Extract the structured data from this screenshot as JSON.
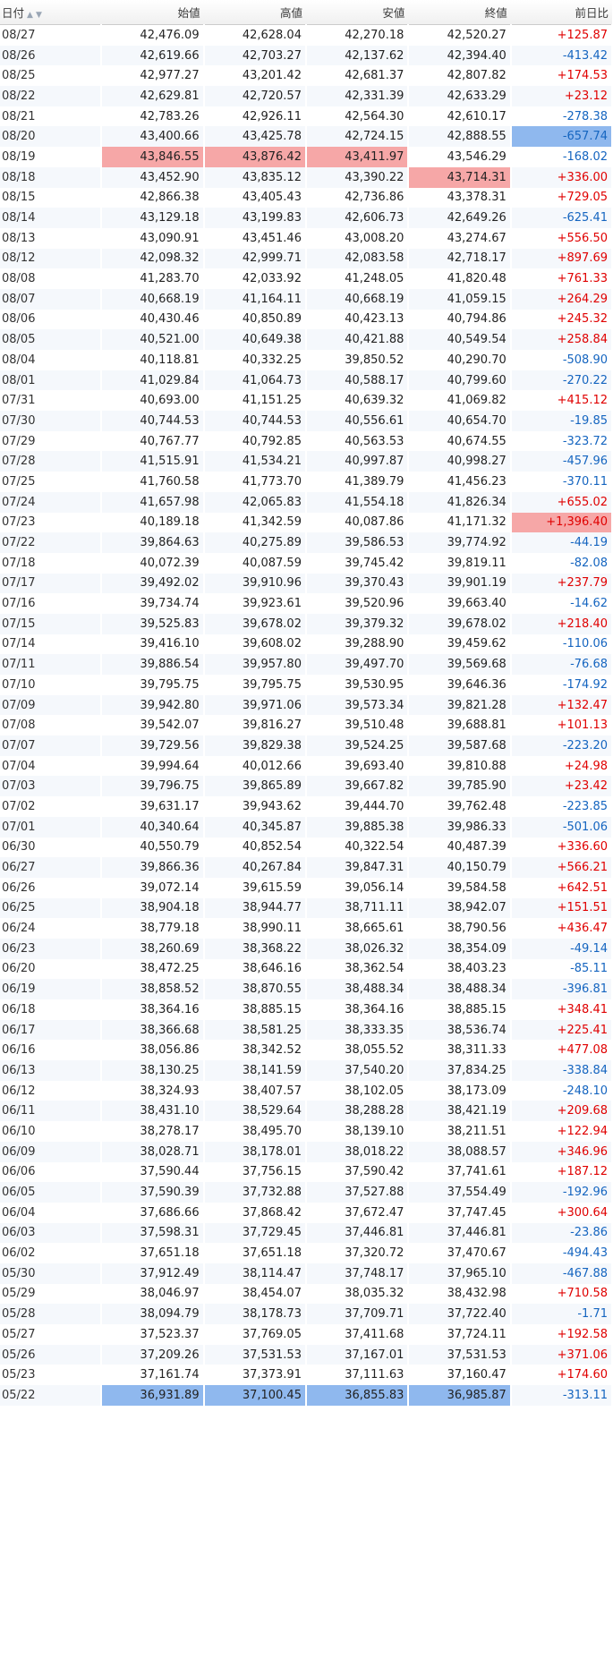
{
  "table": {
    "headers": {
      "date": "日付",
      "open": "始値",
      "high": "高値",
      "low": "安値",
      "close": "終値",
      "change": "前日比"
    },
    "sort_icons": [
      "sort-asc-icon",
      "sort-desc-icon"
    ],
    "highlight_colors": {
      "red": "#f6a7a7",
      "blue": "#8fb8ee"
    },
    "change_colors": {
      "up": "#e00000",
      "down": "#1565c0"
    },
    "rows": [
      {
        "date": "08/27",
        "open": "42,476.09",
        "high": "42,628.04",
        "low": "42,270.18",
        "close": "42,520.27",
        "change": "+125.87"
      },
      {
        "date": "08/26",
        "open": "42,619.66",
        "high": "42,703.27",
        "low": "42,137.62",
        "close": "42,394.40",
        "change": "-413.42"
      },
      {
        "date": "08/25",
        "open": "42,977.27",
        "high": "43,201.42",
        "low": "42,681.37",
        "close": "42,807.82",
        "change": "+174.53"
      },
      {
        "date": "08/22",
        "open": "42,629.81",
        "high": "42,720.57",
        "low": "42,331.39",
        "close": "42,633.29",
        "change": "+23.12"
      },
      {
        "date": "08/21",
        "open": "42,783.26",
        "high": "42,926.11",
        "low": "42,564.30",
        "close": "42,610.17",
        "change": "-278.38"
      },
      {
        "date": "08/20",
        "open": "43,400.66",
        "high": "43,425.78",
        "low": "42,724.15",
        "close": "42,888.55",
        "change": "-657.74",
        "hl": {
          "change": "blue"
        }
      },
      {
        "date": "08/19",
        "open": "43,846.55",
        "high": "43,876.42",
        "low": "43,411.97",
        "close": "43,546.29",
        "change": "-168.02",
        "hl": {
          "open": "red",
          "high": "red",
          "low": "red"
        }
      },
      {
        "date": "08/18",
        "open": "43,452.90",
        "high": "43,835.12",
        "low": "43,390.22",
        "close": "43,714.31",
        "change": "+336.00",
        "hl": {
          "close": "red"
        }
      },
      {
        "date": "08/15",
        "open": "42,866.38",
        "high": "43,405.43",
        "low": "42,736.86",
        "close": "43,378.31",
        "change": "+729.05"
      },
      {
        "date": "08/14",
        "open": "43,129.18",
        "high": "43,199.83",
        "low": "42,606.73",
        "close": "42,649.26",
        "change": "-625.41"
      },
      {
        "date": "08/13",
        "open": "43,090.91",
        "high": "43,451.46",
        "low": "43,008.20",
        "close": "43,274.67",
        "change": "+556.50"
      },
      {
        "date": "08/12",
        "open": "42,098.32",
        "high": "42,999.71",
        "low": "42,083.58",
        "close": "42,718.17",
        "change": "+897.69"
      },
      {
        "date": "08/08",
        "open": "41,283.70",
        "high": "42,033.92",
        "low": "41,248.05",
        "close": "41,820.48",
        "change": "+761.33"
      },
      {
        "date": "08/07",
        "open": "40,668.19",
        "high": "41,164.11",
        "low": "40,668.19",
        "close": "41,059.15",
        "change": "+264.29"
      },
      {
        "date": "08/06",
        "open": "40,430.46",
        "high": "40,850.89",
        "low": "40,423.13",
        "close": "40,794.86",
        "change": "+245.32"
      },
      {
        "date": "08/05",
        "open": "40,521.00",
        "high": "40,649.38",
        "low": "40,421.88",
        "close": "40,549.54",
        "change": "+258.84"
      },
      {
        "date": "08/04",
        "open": "40,118.81",
        "high": "40,332.25",
        "low": "39,850.52",
        "close": "40,290.70",
        "change": "-508.90"
      },
      {
        "date": "08/01",
        "open": "41,029.84",
        "high": "41,064.73",
        "low": "40,588.17",
        "close": "40,799.60",
        "change": "-270.22"
      },
      {
        "date": "07/31",
        "open": "40,693.00",
        "high": "41,151.25",
        "low": "40,639.32",
        "close": "41,069.82",
        "change": "+415.12"
      },
      {
        "date": "07/30",
        "open": "40,744.53",
        "high": "40,744.53",
        "low": "40,556.61",
        "close": "40,654.70",
        "change": "-19.85"
      },
      {
        "date": "07/29",
        "open": "40,767.77",
        "high": "40,792.85",
        "low": "40,563.53",
        "close": "40,674.55",
        "change": "-323.72"
      },
      {
        "date": "07/28",
        "open": "41,515.91",
        "high": "41,534.21",
        "low": "40,997.87",
        "close": "40,998.27",
        "change": "-457.96"
      },
      {
        "date": "07/25",
        "open": "41,760.58",
        "high": "41,773.70",
        "low": "41,389.79",
        "close": "41,456.23",
        "change": "-370.11"
      },
      {
        "date": "07/24",
        "open": "41,657.98",
        "high": "42,065.83",
        "low": "41,554.18",
        "close": "41,826.34",
        "change": "+655.02"
      },
      {
        "date": "07/23",
        "open": "40,189.18",
        "high": "41,342.59",
        "low": "40,087.86",
        "close": "41,171.32",
        "change": "+1,396.40",
        "hl": {
          "change": "red"
        }
      },
      {
        "date": "07/22",
        "open": "39,864.63",
        "high": "40,275.89",
        "low": "39,586.53",
        "close": "39,774.92",
        "change": "-44.19"
      },
      {
        "date": "07/18",
        "open": "40,072.39",
        "high": "40,087.59",
        "low": "39,745.42",
        "close": "39,819.11",
        "change": "-82.08"
      },
      {
        "date": "07/17",
        "open": "39,492.02",
        "high": "39,910.96",
        "low": "39,370.43",
        "close": "39,901.19",
        "change": "+237.79"
      },
      {
        "date": "07/16",
        "open": "39,734.74",
        "high": "39,923.61",
        "low": "39,520.96",
        "close": "39,663.40",
        "change": "-14.62"
      },
      {
        "date": "07/15",
        "open": "39,525.83",
        "high": "39,678.02",
        "low": "39,379.32",
        "close": "39,678.02",
        "change": "+218.40"
      },
      {
        "date": "07/14",
        "open": "39,416.10",
        "high": "39,608.02",
        "low": "39,288.90",
        "close": "39,459.62",
        "change": "-110.06"
      },
      {
        "date": "07/11",
        "open": "39,886.54",
        "high": "39,957.80",
        "low": "39,497.70",
        "close": "39,569.68",
        "change": "-76.68"
      },
      {
        "date": "07/10",
        "open": "39,795.75",
        "high": "39,795.75",
        "low": "39,530.95",
        "close": "39,646.36",
        "change": "-174.92"
      },
      {
        "date": "07/09",
        "open": "39,942.80",
        "high": "39,971.06",
        "low": "39,573.34",
        "close": "39,821.28",
        "change": "+132.47"
      },
      {
        "date": "07/08",
        "open": "39,542.07",
        "high": "39,816.27",
        "low": "39,510.48",
        "close": "39,688.81",
        "change": "+101.13"
      },
      {
        "date": "07/07",
        "open": "39,729.56",
        "high": "39,829.38",
        "low": "39,524.25",
        "close": "39,587.68",
        "change": "-223.20"
      },
      {
        "date": "07/04",
        "open": "39,994.64",
        "high": "40,012.66",
        "low": "39,693.40",
        "close": "39,810.88",
        "change": "+24.98"
      },
      {
        "date": "07/03",
        "open": "39,796.75",
        "high": "39,865.89",
        "low": "39,667.82",
        "close": "39,785.90",
        "change": "+23.42"
      },
      {
        "date": "07/02",
        "open": "39,631.17",
        "high": "39,943.62",
        "low": "39,444.70",
        "close": "39,762.48",
        "change": "-223.85"
      },
      {
        "date": "07/01",
        "open": "40,340.64",
        "high": "40,345.87",
        "low": "39,885.38",
        "close": "39,986.33",
        "change": "-501.06"
      },
      {
        "date": "06/30",
        "open": "40,550.79",
        "high": "40,852.54",
        "low": "40,322.54",
        "close": "40,487.39",
        "change": "+336.60"
      },
      {
        "date": "06/27",
        "open": "39,866.36",
        "high": "40,267.84",
        "low": "39,847.31",
        "close": "40,150.79",
        "change": "+566.21"
      },
      {
        "date": "06/26",
        "open": "39,072.14",
        "high": "39,615.59",
        "low": "39,056.14",
        "close": "39,584.58",
        "change": "+642.51"
      },
      {
        "date": "06/25",
        "open": "38,904.18",
        "high": "38,944.77",
        "low": "38,711.11",
        "close": "38,942.07",
        "change": "+151.51"
      },
      {
        "date": "06/24",
        "open": "38,779.18",
        "high": "38,990.11",
        "low": "38,665.61",
        "close": "38,790.56",
        "change": "+436.47"
      },
      {
        "date": "06/23",
        "open": "38,260.69",
        "high": "38,368.22",
        "low": "38,026.32",
        "close": "38,354.09",
        "change": "-49.14"
      },
      {
        "date": "06/20",
        "open": "38,472.25",
        "high": "38,646.16",
        "low": "38,362.54",
        "close": "38,403.23",
        "change": "-85.11"
      },
      {
        "date": "06/19",
        "open": "38,858.52",
        "high": "38,870.55",
        "low": "38,488.34",
        "close": "38,488.34",
        "change": "-396.81"
      },
      {
        "date": "06/18",
        "open": "38,364.16",
        "high": "38,885.15",
        "low": "38,364.16",
        "close": "38,885.15",
        "change": "+348.41"
      },
      {
        "date": "06/17",
        "open": "38,366.68",
        "high": "38,581.25",
        "low": "38,333.35",
        "close": "38,536.74",
        "change": "+225.41"
      },
      {
        "date": "06/16",
        "open": "38,056.86",
        "high": "38,342.52",
        "low": "38,055.52",
        "close": "38,311.33",
        "change": "+477.08"
      },
      {
        "date": "06/13",
        "open": "38,130.25",
        "high": "38,141.59",
        "low": "37,540.20",
        "close": "37,834.25",
        "change": "-338.84"
      },
      {
        "date": "06/12",
        "open": "38,324.93",
        "high": "38,407.57",
        "low": "38,102.05",
        "close": "38,173.09",
        "change": "-248.10"
      },
      {
        "date": "06/11",
        "open": "38,431.10",
        "high": "38,529.64",
        "low": "38,288.28",
        "close": "38,421.19",
        "change": "+209.68"
      },
      {
        "date": "06/10",
        "open": "38,278.17",
        "high": "38,495.70",
        "low": "38,139.10",
        "close": "38,211.51",
        "change": "+122.94"
      },
      {
        "date": "06/09",
        "open": "38,028.71",
        "high": "38,178.01",
        "low": "38,018.22",
        "close": "38,088.57",
        "change": "+346.96"
      },
      {
        "date": "06/06",
        "open": "37,590.44",
        "high": "37,756.15",
        "low": "37,590.42",
        "close": "37,741.61",
        "change": "+187.12"
      },
      {
        "date": "06/05",
        "open": "37,590.39",
        "high": "37,732.88",
        "low": "37,527.88",
        "close": "37,554.49",
        "change": "-192.96"
      },
      {
        "date": "06/04",
        "open": "37,686.66",
        "high": "37,868.42",
        "low": "37,672.47",
        "close": "37,747.45",
        "change": "+300.64"
      },
      {
        "date": "06/03",
        "open": "37,598.31",
        "high": "37,729.45",
        "low": "37,446.81",
        "close": "37,446.81",
        "change": "-23.86"
      },
      {
        "date": "06/02",
        "open": "37,651.18",
        "high": "37,651.18",
        "low": "37,320.72",
        "close": "37,470.67",
        "change": "-494.43"
      },
      {
        "date": "05/30",
        "open": "37,912.49",
        "high": "38,114.47",
        "low": "37,748.17",
        "close": "37,965.10",
        "change": "-467.88"
      },
      {
        "date": "05/29",
        "open": "38,046.97",
        "high": "38,454.07",
        "low": "38,035.32",
        "close": "38,432.98",
        "change": "+710.58"
      },
      {
        "date": "05/28",
        "open": "38,094.79",
        "high": "38,178.73",
        "low": "37,709.71",
        "close": "37,722.40",
        "change": "-1.71"
      },
      {
        "date": "05/27",
        "open": "37,523.37",
        "high": "37,769.05",
        "low": "37,411.68",
        "close": "37,724.11",
        "change": "+192.58"
      },
      {
        "date": "05/26",
        "open": "37,209.26",
        "high": "37,531.53",
        "low": "37,167.01",
        "close": "37,531.53",
        "change": "+371.06"
      },
      {
        "date": "05/23",
        "open": "37,161.74",
        "high": "37,373.91",
        "low": "37,111.63",
        "close": "37,160.47",
        "change": "+174.60"
      },
      {
        "date": "05/22",
        "open": "36,931.89",
        "high": "37,100.45",
        "low": "36,855.83",
        "close": "36,985.87",
        "change": "-313.11",
        "hl": {
          "open": "blue",
          "high": "blue",
          "low": "blue",
          "close": "blue"
        }
      }
    ]
  }
}
